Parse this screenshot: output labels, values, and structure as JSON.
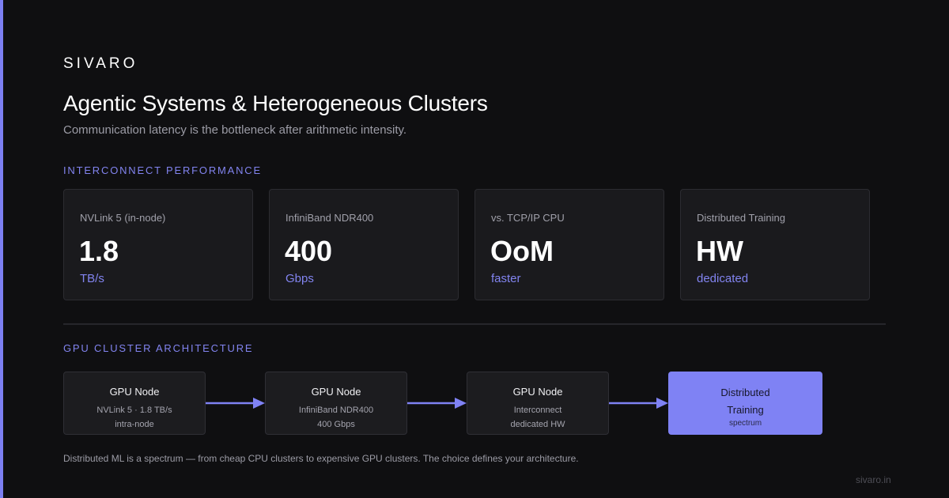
{
  "brand": "SIVARO",
  "title": "Agentic Systems & Heterogeneous Clusters",
  "subtitle": "Communication latency is the bottleneck after arithmetic intensity.",
  "sections": {
    "interconnect": "INTERCONNECT PERFORMANCE",
    "architecture": "GPU CLUSTER ARCHITECTURE"
  },
  "stats": [
    {
      "label": "NVLink 5 (in-node)",
      "value": "1.8",
      "unit": "TB/s"
    },
    {
      "label": "InfiniBand NDR400",
      "value": "400",
      "unit": "Gbps"
    },
    {
      "label": "vs. TCP/IP CPU",
      "value": "OoM",
      "unit": "faster"
    },
    {
      "label": "Distributed Training",
      "value": "HW",
      "unit": "dedicated"
    }
  ],
  "nodes": [
    {
      "title": "GPU Node",
      "line1": "NVLink 5 · 1.8 TB/s",
      "line2": "intra-node"
    },
    {
      "title": "GPU Node",
      "line1": "InfiniBand NDR400",
      "line2": "400 Gbps"
    },
    {
      "title": "GPU Node",
      "line1": "Interconnect",
      "line2": "dedicated HW"
    }
  ],
  "final_node": {
    "title_line1": "Distributed",
    "title_line2": "Training",
    "sub": "spectrum"
  },
  "footnote": "Distributed ML is a spectrum — from cheap CPU clusters to expensive GPU clusters. The choice defines your architecture.",
  "site": "sivaro.in",
  "colors": {
    "accent": "#7f82f4",
    "background": "#0f0f11",
    "card": "#1a1a1d"
  }
}
